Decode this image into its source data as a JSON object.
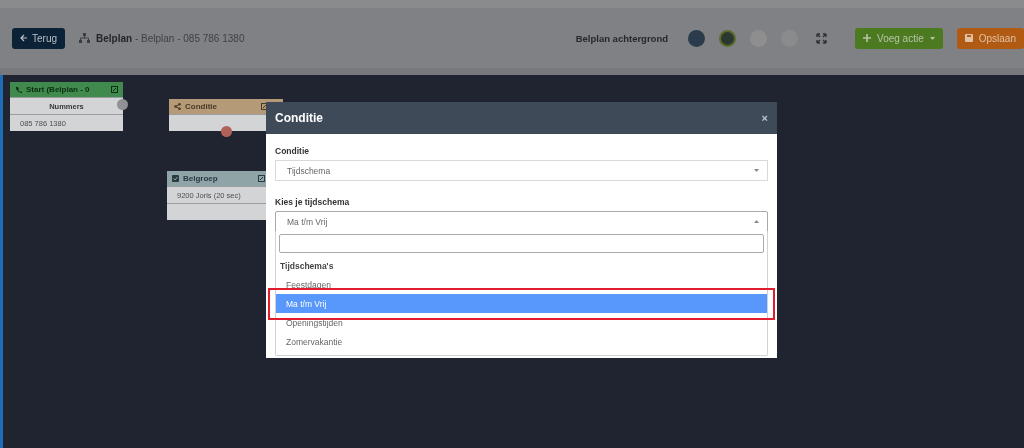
{
  "header": {
    "back_button": "Terug",
    "breadcrumb": "**Belplan** - Belplan - 085 786 1380",
    "background_label": "Belplan achtergrond",
    "swatches": [
      {
        "color": "#2c3b4b",
        "selected": false
      },
      {
        "color": "#2a3830",
        "selected": true
      },
      {
        "color": "#8e8e8e",
        "selected": false
      },
      {
        "color": "#8a8b8d",
        "selected": false
      }
    ],
    "buttons": [
      {
        "kind": "add",
        "label": "Voeg actie"
      },
      {
        "kind": "save",
        "label": "Opslaan"
      }
    ]
  },
  "nodes": [
    {
      "kind": "start",
      "title": "Start (Belplan - 0",
      "rows": [
        {
          "text": "Nummers",
          "kind": "heading"
        },
        {
          "text": "085 786 1380",
          "kind": "item"
        }
      ]
    },
    {
      "kind": "condition",
      "title": "Conditie"
    },
    {
      "kind": "group",
      "title": "Belgroep",
      "rows": [
        {
          "text": "9200 Joris (20 sec)",
          "kind": "item"
        },
        {
          "text": "",
          "kind": "empty"
        }
      ]
    }
  ],
  "modal": {
    "title": "Conditie",
    "close": "×",
    "fields": [
      {
        "label": "Conditie",
        "value": "Tijdschema",
        "expanded": false
      },
      {
        "label": "Kies je tijdschema",
        "value": "Ma t/m Vrij",
        "expanded": true
      }
    ],
    "dropdown": {
      "group": "Tijdschema's",
      "options": [
        {
          "label": "Feestdagen",
          "selected": false,
          "outlined": false
        },
        {
          "label": "Ma t/m Vrij",
          "selected": true,
          "outlined": true
        },
        {
          "label": "Openingstijden",
          "selected": false,
          "outlined": false
        },
        {
          "label": "Zomervakantie",
          "selected": false,
          "outlined": false
        }
      ]
    }
  }
}
